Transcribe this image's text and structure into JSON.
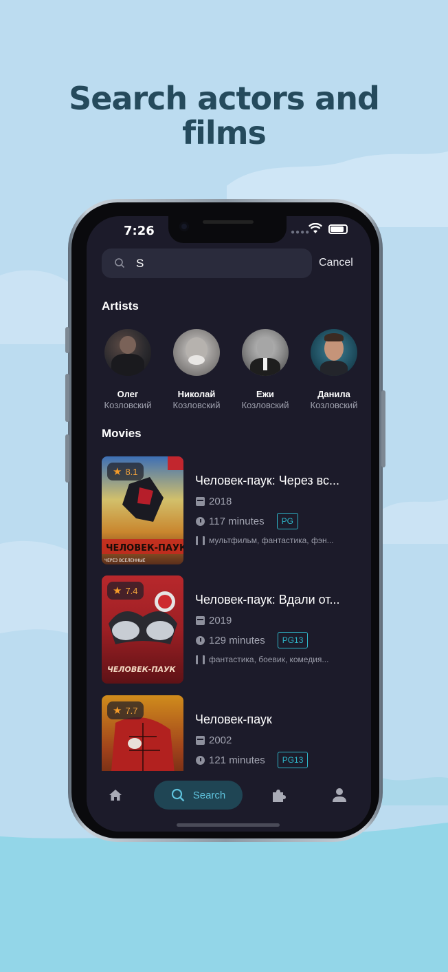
{
  "headline": {
    "line1": "Search actors and",
    "line2": "films"
  },
  "status": {
    "time": "7:26"
  },
  "search": {
    "value": "S",
    "cancel_label": "Cancel"
  },
  "artists_section": {
    "title": "Artists"
  },
  "artists": [
    {
      "first": "Олег",
      "last": "Козловский"
    },
    {
      "first": "Николай",
      "last": "Козловский"
    },
    {
      "first": "Ежи",
      "last": "Козловский"
    },
    {
      "first": "Данила",
      "last": "Козловский"
    }
  ],
  "movies_section": {
    "title": "Movies"
  },
  "movies": [
    {
      "rating": "8.1",
      "title": "Человек-паук: Через вс...",
      "year": "2018",
      "duration": "117 minutes",
      "age": "PG",
      "genres": "мультфильм, фантастика, фэн..."
    },
    {
      "rating": "7.4",
      "title": "Человек-паук: Вдали от...",
      "year": "2019",
      "duration": "129 minutes",
      "age": "PG13",
      "genres": "фантастика, боевик, комедия..."
    },
    {
      "rating": "7.7",
      "title": "Человек-паук",
      "year": "2002",
      "duration": "121 minutes",
      "age": "PG13",
      "genres": ""
    }
  ],
  "nav": {
    "search_label": "Search"
  },
  "colors": {
    "background": "#bcdcf0",
    "screen": "#1c1b2a",
    "accent": "#2eb6c9",
    "rating_star": "#f49a28",
    "headline": "#254a5c"
  }
}
